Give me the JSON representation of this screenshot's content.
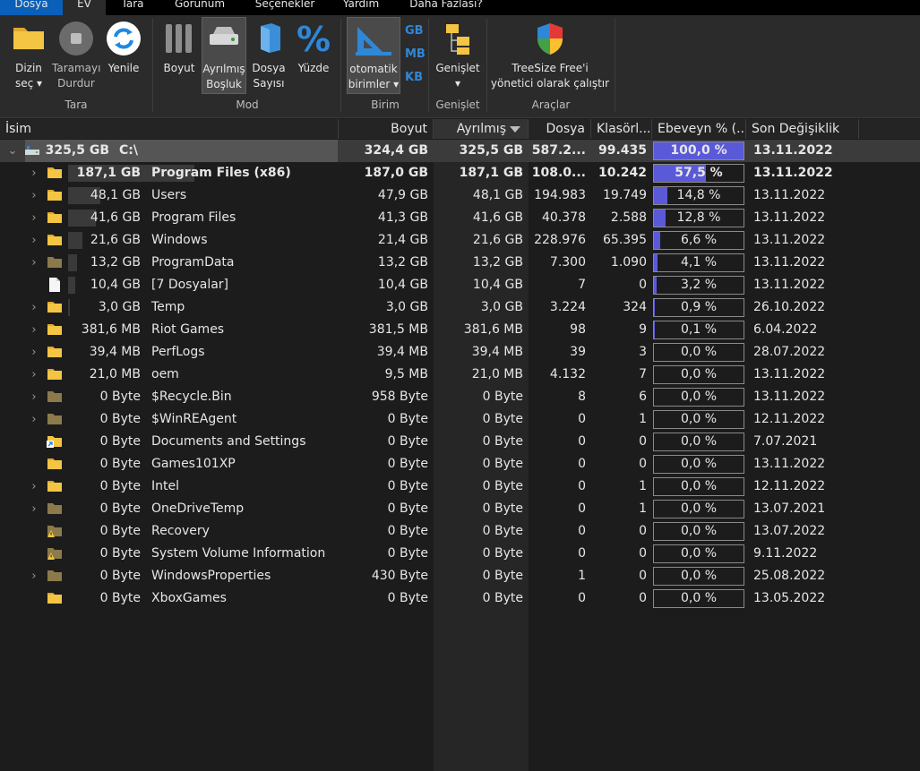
{
  "menu": {
    "tabs": [
      "Dosya",
      "EV",
      "Tara",
      "Görünüm",
      "Seçenekler",
      "Yardım",
      "Daha Fazlası?"
    ]
  },
  "ribbon": {
    "select_dir": "Dizin\nseç ▾",
    "stop_scan": "Taramayı\nDurdur",
    "refresh": "Yenile",
    "size": "Boyut",
    "allocated": "Ayrılmış\nBoşluk",
    "file_count": "Dosya\nSayısı",
    "percent": "Yüzde",
    "auto_units": "otomatik\nbirimler ▾",
    "unit_gb": "GB",
    "unit_mb": "MB",
    "unit_kb": "KB",
    "expand": "Genişlet\n▾",
    "run_admin": "TreeSize Free'i\nyönetici olarak çalıştır",
    "groups": {
      "scan": "Tara",
      "mode": "Mod",
      "unit": "Birim",
      "expand": "Genişlet",
      "tools": "Araçlar"
    }
  },
  "columns": {
    "name": "İsim",
    "size": "Boyut",
    "allocated": "Ayrılmış",
    "files": "Dosya",
    "folders": "Klasörl...",
    "parent_pct": "Ebeveyn % (...",
    "modified": "Son Değişiklik"
  },
  "rows": [
    {
      "name": "C:\\",
      "label": "325,5 GB",
      "size": "324,4 GB",
      "allocated": "325,5 GB",
      "files": "587.2...",
      "folders": "99.435",
      "pct_text": "100,0 %",
      "pct": 100.0,
      "modified": "13.11.2022"
    },
    {
      "name": "Program Files (x86)",
      "label": "187,1 GB",
      "size": "187,0 GB",
      "allocated": "187,1 GB",
      "files": "108.0...",
      "folders": "10.242",
      "pct_text": "57,5 %",
      "pct": 57.5,
      "modified": "13.11.2022"
    },
    {
      "name": "Users",
      "label": "48,1 GB",
      "size": "47,9 GB",
      "allocated": "48,1 GB",
      "files": "194.983",
      "folders": "19.749",
      "pct_text": "14,8 %",
      "pct": 14.8,
      "modified": "13.11.2022"
    },
    {
      "name": "Program Files",
      "label": "41,6 GB",
      "size": "41,3 GB",
      "allocated": "41,6 GB",
      "files": "40.378",
      "folders": "2.588",
      "pct_text": "12,8 %",
      "pct": 12.8,
      "modified": "13.11.2022"
    },
    {
      "name": "Windows",
      "label": "21,6 GB",
      "size": "21,4 GB",
      "allocated": "21,6 GB",
      "files": "228.976",
      "folders": "65.395",
      "pct_text": "6,6 %",
      "pct": 6.6,
      "modified": "13.11.2022"
    },
    {
      "name": "ProgramData",
      "label": "13,2 GB",
      "size": "13,2 GB",
      "allocated": "13,2 GB",
      "files": "7.300",
      "folders": "1.090",
      "pct_text": "4,1 %",
      "pct": 4.1,
      "modified": "13.11.2022"
    },
    {
      "name": "[7 Dosyalar]",
      "label": "10,4 GB",
      "size": "10,4 GB",
      "allocated": "10,4 GB",
      "files": "7",
      "folders": "0",
      "pct_text": "3,2 %",
      "pct": 3.2,
      "modified": "13.11.2022"
    },
    {
      "name": "Temp",
      "label": "3,0 GB",
      "size": "3,0 GB",
      "allocated": "3,0 GB",
      "files": "3.224",
      "folders": "324",
      "pct_text": "0,9 %",
      "pct": 0.9,
      "modified": "26.10.2022"
    },
    {
      "name": "Riot Games",
      "label": "381,6 MB",
      "size": "381,5 MB",
      "allocated": "381,6 MB",
      "files": "98",
      "folders": "9",
      "pct_text": "0,1 %",
      "pct": 0.1,
      "modified": "6.04.2022"
    },
    {
      "name": "PerfLogs",
      "label": "39,4 MB",
      "size": "39,4 MB",
      "allocated": "39,4 MB",
      "files": "39",
      "folders": "3",
      "pct_text": "0,0 %",
      "pct": 0.0,
      "modified": "28.07.2022"
    },
    {
      "name": "oem",
      "label": "21,0 MB",
      "size": "9,5 MB",
      "allocated": "21,0 MB",
      "files": "4.132",
      "folders": "7",
      "pct_text": "0,0 %",
      "pct": 0.0,
      "modified": "13.11.2022"
    },
    {
      "name": "$Recycle.Bin",
      "label": "0 Byte",
      "size": "958 Byte",
      "allocated": "0 Byte",
      "files": "8",
      "folders": "6",
      "pct_text": "0,0 %",
      "pct": 0.0,
      "modified": "13.11.2022"
    },
    {
      "name": "$WinREAgent",
      "label": "0 Byte",
      "size": "0 Byte",
      "allocated": "0 Byte",
      "files": "0",
      "folders": "1",
      "pct_text": "0,0 %",
      "pct": 0.0,
      "modified": "12.11.2022"
    },
    {
      "name": "Documents and Settings",
      "label": "0 Byte",
      "size": "0 Byte",
      "allocated": "0 Byte",
      "files": "0",
      "folders": "0",
      "pct_text": "0,0 %",
      "pct": 0.0,
      "modified": "7.07.2021"
    },
    {
      "name": "Games101XP",
      "label": "0 Byte",
      "size": "0 Byte",
      "allocated": "0 Byte",
      "files": "0",
      "folders": "0",
      "pct_text": "0,0 %",
      "pct": 0.0,
      "modified": "13.11.2022"
    },
    {
      "name": "Intel",
      "label": "0 Byte",
      "size": "0 Byte",
      "allocated": "0 Byte",
      "files": "0",
      "folders": "1",
      "pct_text": "0,0 %",
      "pct": 0.0,
      "modified": "12.11.2022"
    },
    {
      "name": "OneDriveTemp",
      "label": "0 Byte",
      "size": "0 Byte",
      "allocated": "0 Byte",
      "files": "0",
      "folders": "1",
      "pct_text": "0,0 %",
      "pct": 0.0,
      "modified": "13.07.2021"
    },
    {
      "name": "Recovery",
      "label": "0 Byte",
      "size": "0 Byte",
      "allocated": "0 Byte",
      "files": "0",
      "folders": "0",
      "pct_text": "0,0 %",
      "pct": 0.0,
      "modified": "13.07.2022"
    },
    {
      "name": "System Volume Information",
      "label": "0 Byte",
      "size": "0 Byte",
      "allocated": "0 Byte",
      "files": "0",
      "folders": "0",
      "pct_text": "0,0 %",
      "pct": 0.0,
      "modified": "9.11.2022"
    },
    {
      "name": "WindowsProperties",
      "label": "0 Byte",
      "size": "430 Byte",
      "allocated": "0 Byte",
      "files": "1",
      "folders": "0",
      "pct_text": "0,0 %",
      "pct": 0.0,
      "modified": "25.08.2022"
    },
    {
      "name": "XboxGames",
      "label": "0 Byte",
      "size": "0 Byte",
      "allocated": "0 Byte",
      "files": "0",
      "folders": "0",
      "pct_text": "0,0 %",
      "pct": 0.0,
      "modified": "13.05.2022"
    }
  ],
  "row_flags": {
    "expandable": [
      true,
      true,
      true,
      true,
      true,
      true,
      false,
      true,
      true,
      true,
      true,
      true,
      true,
      false,
      false,
      true,
      true,
      false,
      false,
      true,
      false
    ],
    "icon": [
      "drive-icon",
      "folder-icon",
      "folder-icon",
      "folder-icon",
      "folder-icon",
      "folder-dim-icon",
      "file-icon",
      "folder-icon",
      "folder-icon",
      "folder-icon",
      "folder-icon",
      "folder-dim-icon",
      "folder-dim-icon",
      "shortcut-icon",
      "folder-icon",
      "folder-icon",
      "folder-dim-icon",
      "warning-folder-icon",
      "warning-folder-icon",
      "folder-dim-icon",
      "folder-icon"
    ],
    "bold": [
      true,
      true,
      false,
      false,
      false,
      false,
      false,
      false,
      false,
      false,
      false,
      false,
      false,
      false,
      false,
      false,
      false,
      false,
      false,
      false,
      false
    ]
  },
  "colors": {
    "accent": "#5a5ad8",
    "file_tab": "#0a5fb8",
    "folder": "#f4c542",
    "unit_text": "#2f87d8"
  }
}
